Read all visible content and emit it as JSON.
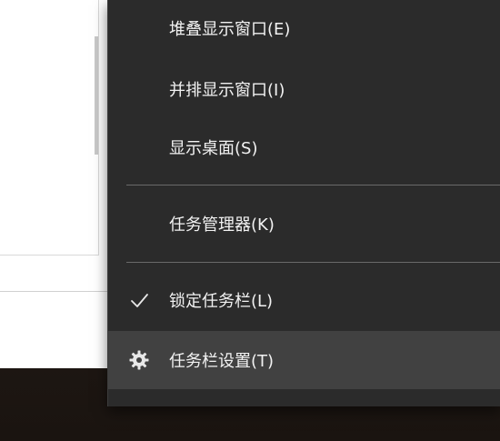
{
  "menu": {
    "items": [
      {
        "label": "堆叠显示窗口(E)",
        "icon": ""
      },
      {
        "label": "并排显示窗口(I)",
        "icon": ""
      },
      {
        "label": "显示桌面(S)",
        "icon": ""
      },
      {
        "label": "任务管理器(K)",
        "icon": ""
      },
      {
        "label": "锁定任务栏(L)",
        "icon": "checkmark-icon"
      },
      {
        "label": "任务栏设置(T)",
        "icon": "gear-icon"
      }
    ],
    "hovered_item": "任务栏设置(T)"
  },
  "colors": {
    "menu_background": "#2b2b2b",
    "menu_hover": "#414141",
    "menu_text": "#f2f2f2",
    "separator": "#6a6a6a"
  }
}
